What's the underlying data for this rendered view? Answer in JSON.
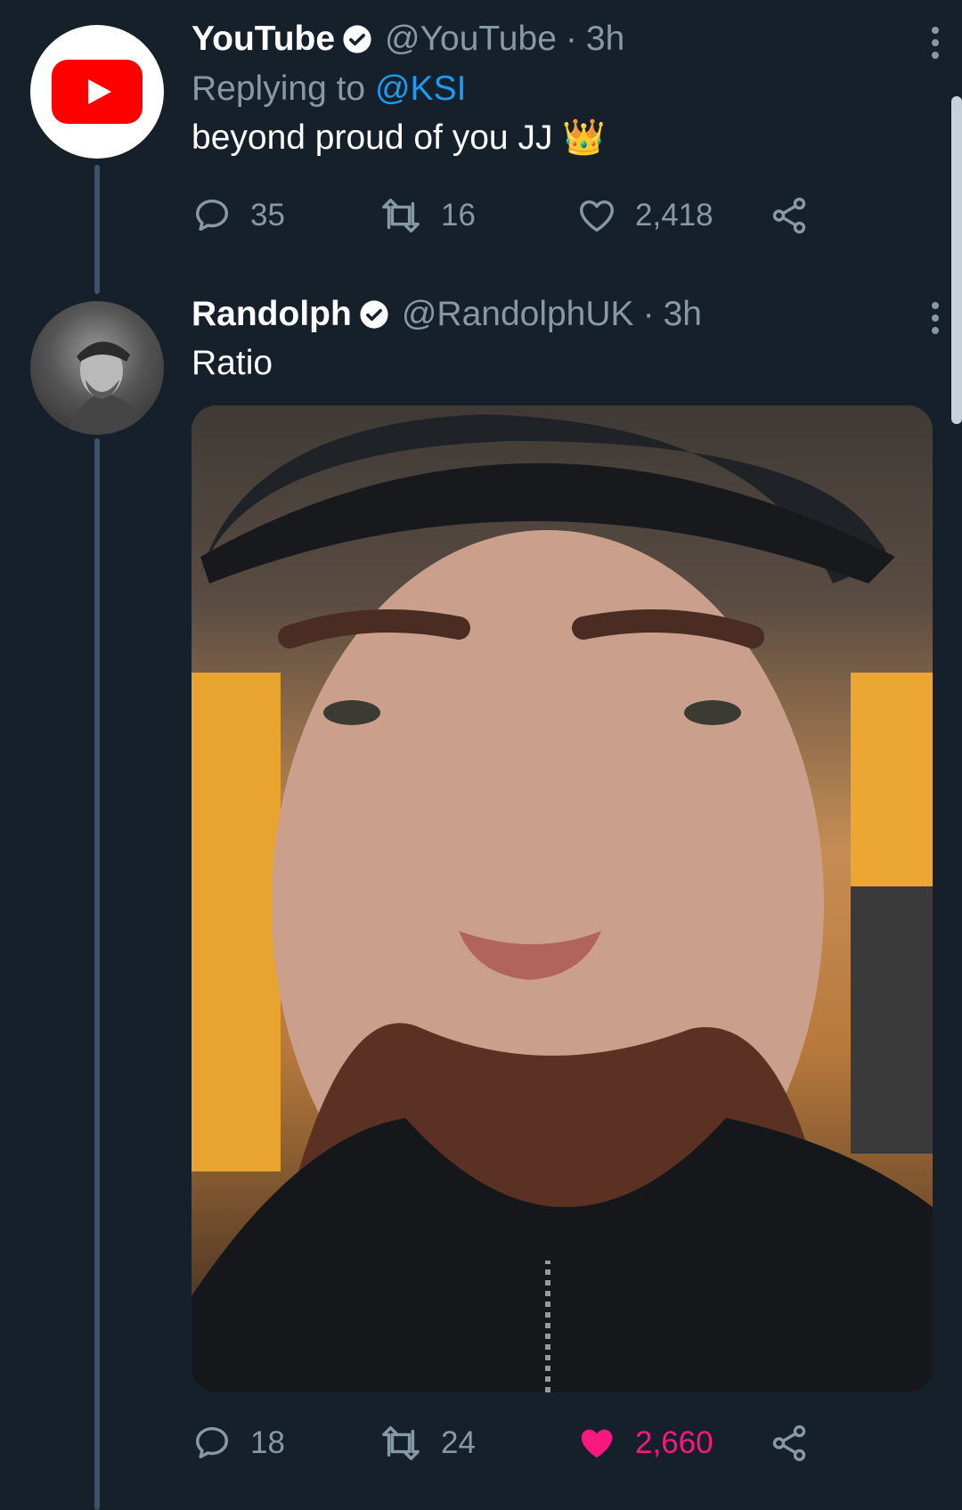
{
  "colors": {
    "background": "#15202b",
    "muted": "#8899a6",
    "mention": "#1d9bf0",
    "like": "#f91880",
    "verified": "#ffffff"
  },
  "tweets": [
    {
      "name": "YouTube",
      "handle": "@YouTube",
      "separator": "·",
      "time": "3h",
      "replying_prefix": "Replying to",
      "replying_handle": "@KSI",
      "text": "beyond proud of you JJ 👑",
      "avatar_icon": "youtube-logo-icon",
      "replies": "35",
      "retweets": "16",
      "likes": "2,418",
      "liked": false
    },
    {
      "name": "Randolph",
      "handle": "@RandolphUK",
      "separator": "·",
      "time": "3h",
      "text": "Ratio",
      "avatar_icon": "profile-photo",
      "media": "photo",
      "replies": "18",
      "retweets": "24",
      "likes": "2,660",
      "liked": true
    }
  ]
}
